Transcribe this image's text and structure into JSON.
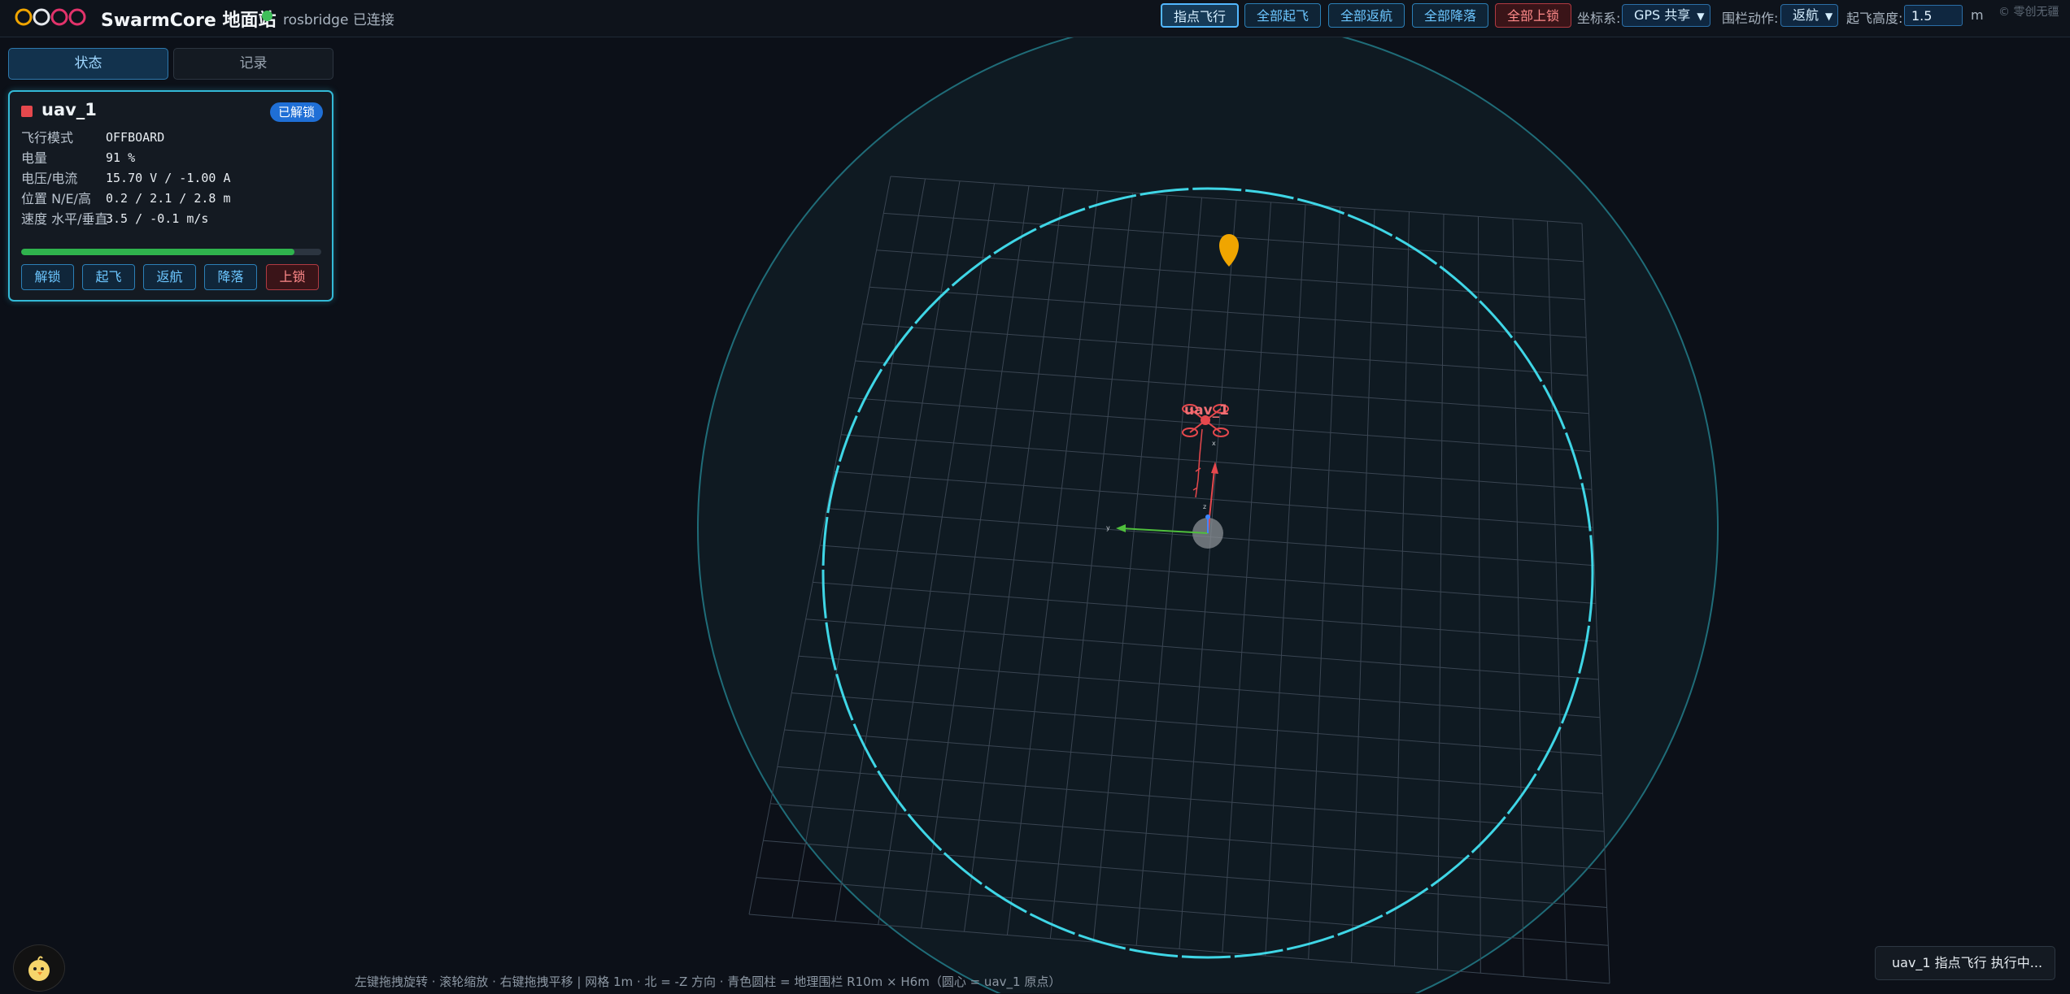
{
  "app": {
    "title": "SwarmCore 地面站",
    "connection_text": "rosbridge 已连接",
    "corner_note": "© 零创无疆"
  },
  "toolbar": {
    "buttons": [
      {
        "label": "指点飞行",
        "variant": "active"
      },
      {
        "label": "全部起飞",
        "variant": "blue"
      },
      {
        "label": "全部返航",
        "variant": "blue"
      },
      {
        "label": "全部降落",
        "variant": "blue"
      },
      {
        "label": "全部上锁",
        "variant": "red"
      }
    ],
    "coord_label": "坐标系:",
    "coord_value": "GPS 共享",
    "fence_label": "围栏动作:",
    "fence_value": "返航",
    "takeoff_label": "起飞高度:",
    "takeoff_value": "1.5",
    "takeoff_unit": "m"
  },
  "sidebar": {
    "tabs": [
      {
        "label": "状态",
        "active": true
      },
      {
        "label": "记录",
        "active": false
      }
    ]
  },
  "uav": {
    "name": "uav_1",
    "status_badge": "已解锁",
    "color": "#e5484d",
    "rows": [
      {
        "label": "飞行模式",
        "value": "OFFBOARD"
      },
      {
        "label": "电量",
        "value": "91 %"
      },
      {
        "label": "电压/电流",
        "value": "15.70 V / -1.00 A"
      },
      {
        "label": "位置 N/E/高",
        "value": "0.2 / 2.1 / 2.8 m"
      },
      {
        "label": "速度 水平/垂直",
        "value": "3.5 / -0.1 m/s"
      }
    ],
    "battery_fraction": 0.91,
    "buttons": [
      {
        "label": "解锁",
        "variant": "blue"
      },
      {
        "label": "起飞",
        "variant": "blue"
      },
      {
        "label": "返航",
        "variant": "blue"
      },
      {
        "label": "降落",
        "variant": "blue"
      },
      {
        "label": "上锁",
        "variant": "red"
      }
    ]
  },
  "scene": {
    "drone_label": "uav_1",
    "axis_x_label": "x",
    "axis_y_label": "y",
    "axis_z_label": "z",
    "fence_color": "#3fd6e6",
    "target_marker_color": "#f0a500",
    "hint": "左键拖拽旋转 · 滚轮缩放 · 右键拖拽平移 | 网格 1m · 北 = -Z 方向 · 青色圆柱 = 地理围栏 R10m × H6m（圆心 = uav_1 原点）"
  },
  "toast": {
    "text": "uav_1 指点飞行 执行中..."
  }
}
